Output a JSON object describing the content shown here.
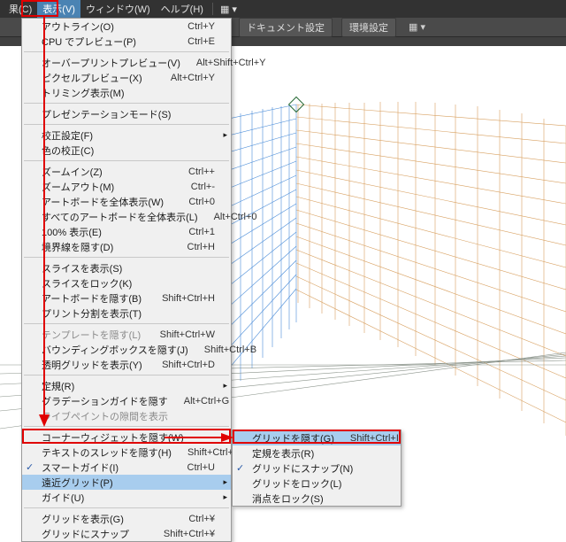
{
  "menubar": {
    "items": [
      "果(C)",
      "表示(V)",
      "ウィンドウ(W)",
      "ヘルプ(H)"
    ]
  },
  "optbar": {
    "doc_settings": "ドキュメント設定",
    "env_settings": "環境設定"
  },
  "menu": [
    {
      "l": "アウトライン(O)",
      "s": "Ctrl+Y"
    },
    {
      "l": "CPU でプレビュー(P)",
      "s": "Ctrl+E"
    },
    {
      "sep": 1
    },
    {
      "l": "オーバープリントプレビュー(V)",
      "s": "Alt+Shift+Ctrl+Y"
    },
    {
      "l": "ピクセルプレビュー(X)",
      "s": "Alt+Ctrl+Y"
    },
    {
      "l": "トリミング表示(M)"
    },
    {
      "sep": 1
    },
    {
      "l": "プレゼンテーションモード(S)"
    },
    {
      "sep": 1
    },
    {
      "l": "校正設定(F)",
      "sub": 1
    },
    {
      "l": "色の校正(C)"
    },
    {
      "sep": 1
    },
    {
      "l": "ズームイン(Z)",
      "s": "Ctrl++"
    },
    {
      "l": "ズームアウト(M)",
      "s": "Ctrl+-"
    },
    {
      "l": "アートボードを全体表示(W)",
      "s": "Ctrl+0"
    },
    {
      "l": "すべてのアートボードを全体表示(L)",
      "s": "Alt+Ctrl+0"
    },
    {
      "l": "100% 表示(E)",
      "s": "Ctrl+1"
    },
    {
      "l": "境界線を隠す(D)",
      "s": "Ctrl+H"
    },
    {
      "sep": 1
    },
    {
      "l": "スライスを表示(S)"
    },
    {
      "l": "スライスをロック(K)"
    },
    {
      "l": "アートボードを隠す(B)",
      "s": "Shift+Ctrl+H"
    },
    {
      "l": "プリント分割を表示(T)"
    },
    {
      "sep": 1
    },
    {
      "l": "テンプレートを隠す(L)",
      "s": "Shift+Ctrl+W",
      "dis": 1
    },
    {
      "l": "バウンディングボックスを隠す(J)",
      "s": "Shift+Ctrl+B"
    },
    {
      "l": "透明グリッドを表示(Y)",
      "s": "Shift+Ctrl+D"
    },
    {
      "sep": 1
    },
    {
      "l": "定規(R)",
      "sub": 1
    },
    {
      "l": "グラデーションガイドを隠す",
      "s": "Alt+Ctrl+G"
    },
    {
      "l": "ライブペイントの隙間を表示",
      "dis": 1
    },
    {
      "sep": 1
    },
    {
      "l": "コーナーウィジェットを隠す(W)"
    },
    {
      "l": "テキストのスレッドを隠す(H)",
      "s": "Shift+Ctrl+Y"
    },
    {
      "l": "スマートガイド(I)",
      "s": "Ctrl+U",
      "chk": 1
    },
    {
      "l": "遠近グリッド(P)",
      "sub": 1,
      "hl": 1
    },
    {
      "l": "ガイド(U)",
      "sub": 1
    },
    {
      "sep": 1
    },
    {
      "l": "グリッドを表示(G)",
      "s": "Ctrl+¥"
    },
    {
      "l": "グリッドにスナップ",
      "s": "Shift+Ctrl+¥"
    }
  ],
  "submenu": [
    {
      "l": "グリッドを隠す(G)",
      "s": "Shift+Ctrl+I",
      "hl": 1
    },
    {
      "l": "定規を表示(R)"
    },
    {
      "l": "グリッドにスナップ(N)",
      "chk": 1
    },
    {
      "l": "グリッドをロック(L)"
    },
    {
      "l": "消点をロック(S)"
    }
  ]
}
